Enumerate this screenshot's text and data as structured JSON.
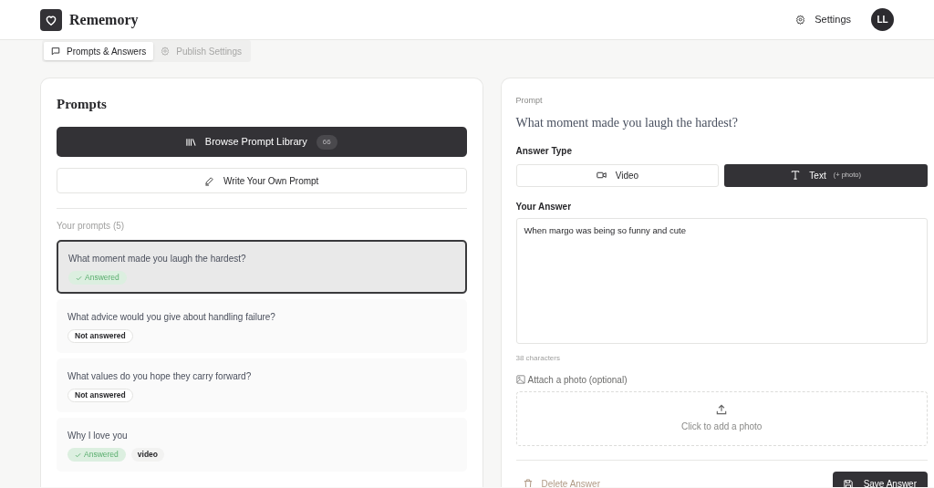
{
  "header": {
    "app_name": "Rememory",
    "settings_label": "Settings",
    "avatar_initials": "LL"
  },
  "tabs": [
    {
      "label": "Prompts & Answers",
      "kind": "chat",
      "selected": true
    },
    {
      "label": "Publish Settings",
      "kind": "gear",
      "selected": false
    }
  ],
  "prompts_panel": {
    "title": "Prompts",
    "browse_button": {
      "label": "Browse Prompt Library",
      "count": "66"
    },
    "write_button": "Write Your Own Prompt",
    "list_heading": "Your prompts (5)",
    "items": [
      {
        "question": "What moment made you laugh the hardest?",
        "kind": "answered",
        "status_label": "Answered",
        "selected": true
      },
      {
        "question": "What advice would you give about handling failure?",
        "kind": "not_answered",
        "status_label": "Not answered",
        "selected": false
      },
      {
        "question": "What values do you hope they carry forward?",
        "kind": "not_answered",
        "status_label": "Not answered",
        "selected": false
      },
      {
        "question": "Why I love you",
        "kind": "answered",
        "status_label": "Answered",
        "tag": "video",
        "selected": false
      }
    ]
  },
  "answer_panel": {
    "prompt_label": "Prompt",
    "prompt_text": "What moment made you laugh the hardest?",
    "answer_type_label": "Answer Type",
    "answer_types": [
      {
        "label": "Video",
        "kind": "video",
        "selected": false
      },
      {
        "label": "Text",
        "note": "(+ photo)",
        "kind": "text",
        "selected": true
      }
    ],
    "answer_label": "Your Answer",
    "answer_value": "When margo was being so funny and cute",
    "char_count": "38 characters",
    "attach_label": "Attach a photo (optional)",
    "dropzone_text": "Click to add a photo",
    "delete_button": "Delete Answer",
    "save_button": "Save Answer"
  }
}
